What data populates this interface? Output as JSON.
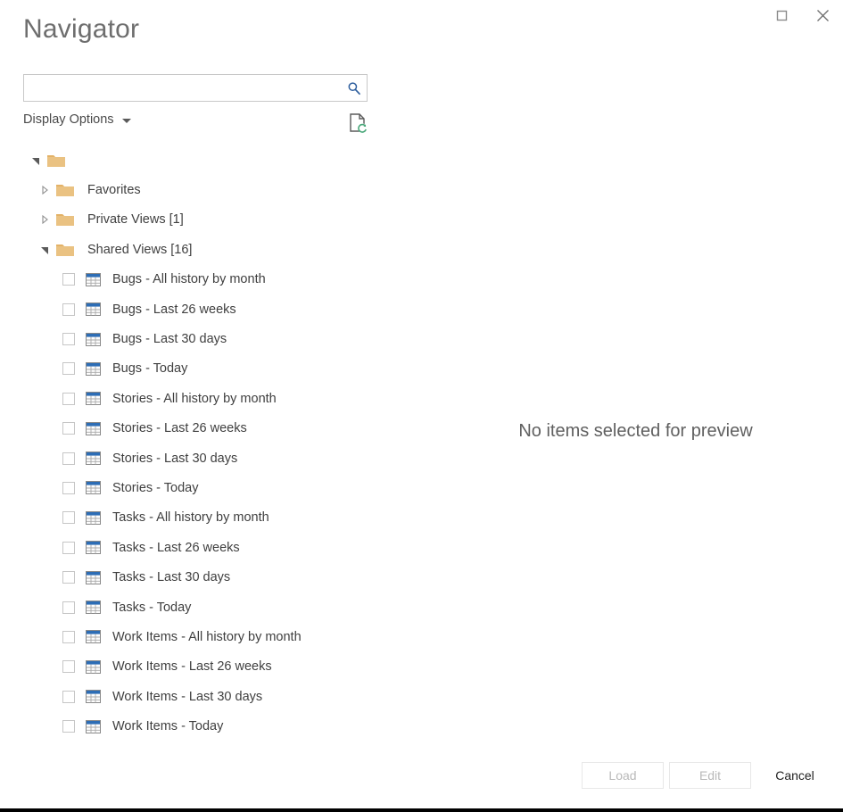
{
  "window": {
    "title": "Navigator",
    "controls": [
      {
        "name": "maximize-button",
        "icon": "maximize-icon",
        "label": "Maximize"
      },
      {
        "name": "close-button",
        "icon": "close-icon",
        "label": "Close"
      }
    ]
  },
  "search": {
    "value": "",
    "placeholder": "",
    "icon": "search-icon",
    "icon_color": "#2f5f9e"
  },
  "toolbar": {
    "display_options_label": "Display Options",
    "display_options_caret": "chevron-down-icon",
    "refresh_preview_icon": "document-refresh-icon",
    "refresh_badge_color": "#4ba87b"
  },
  "tree": {
    "root": {
      "label": "",
      "expanded": true,
      "icon": "folder-icon"
    },
    "nodes": [
      {
        "label": "Favorites",
        "expanded": false,
        "icon": "folder-icon"
      },
      {
        "label": "Private Views [1]",
        "expanded": false,
        "icon": "folder-icon"
      },
      {
        "label": "Shared Views [16]",
        "expanded": true,
        "icon": "folder-icon"
      }
    ],
    "items": [
      {
        "label": "Bugs - All history by month",
        "checked": false,
        "icon": "table-icon"
      },
      {
        "label": "Bugs - Last 26 weeks",
        "checked": false,
        "icon": "table-icon"
      },
      {
        "label": "Bugs - Last 30 days",
        "checked": false,
        "icon": "table-icon"
      },
      {
        "label": "Bugs - Today",
        "checked": false,
        "icon": "table-icon"
      },
      {
        "label": "Stories - All history by month",
        "checked": false,
        "icon": "table-icon"
      },
      {
        "label": "Stories - Last 26 weeks",
        "checked": false,
        "icon": "table-icon"
      },
      {
        "label": "Stories - Last 30 days",
        "checked": false,
        "icon": "table-icon"
      },
      {
        "label": "Stories - Today",
        "checked": false,
        "icon": "table-icon"
      },
      {
        "label": "Tasks - All history by month",
        "checked": false,
        "icon": "table-icon"
      },
      {
        "label": "Tasks - Last 26 weeks",
        "checked": false,
        "icon": "table-icon"
      },
      {
        "label": "Tasks - Last 30 days",
        "checked": false,
        "icon": "table-icon"
      },
      {
        "label": "Tasks - Today",
        "checked": false,
        "icon": "table-icon"
      },
      {
        "label": "Work Items - All history by month",
        "checked": false,
        "icon": "table-icon"
      },
      {
        "label": "Work Items - Last 26 weeks",
        "checked": false,
        "icon": "table-icon"
      },
      {
        "label": "Work Items - Last 30 days",
        "checked": false,
        "icon": "table-icon"
      },
      {
        "label": "Work Items - Today",
        "checked": false,
        "icon": "table-icon"
      }
    ]
  },
  "preview": {
    "empty_message": "No items selected for preview"
  },
  "footer": {
    "load_label": "Load",
    "edit_label": "Edit",
    "cancel_label": "Cancel",
    "load_enabled": false,
    "edit_enabled": false,
    "cancel_enabled": true
  },
  "colors": {
    "folder": "#eac282",
    "folder_tab": "#e3b267",
    "table_header": "#2d6db5",
    "title_text": "#6e6e6e",
    "body_text": "#3f3f3f",
    "disabled_text": "#b9b9b9"
  }
}
